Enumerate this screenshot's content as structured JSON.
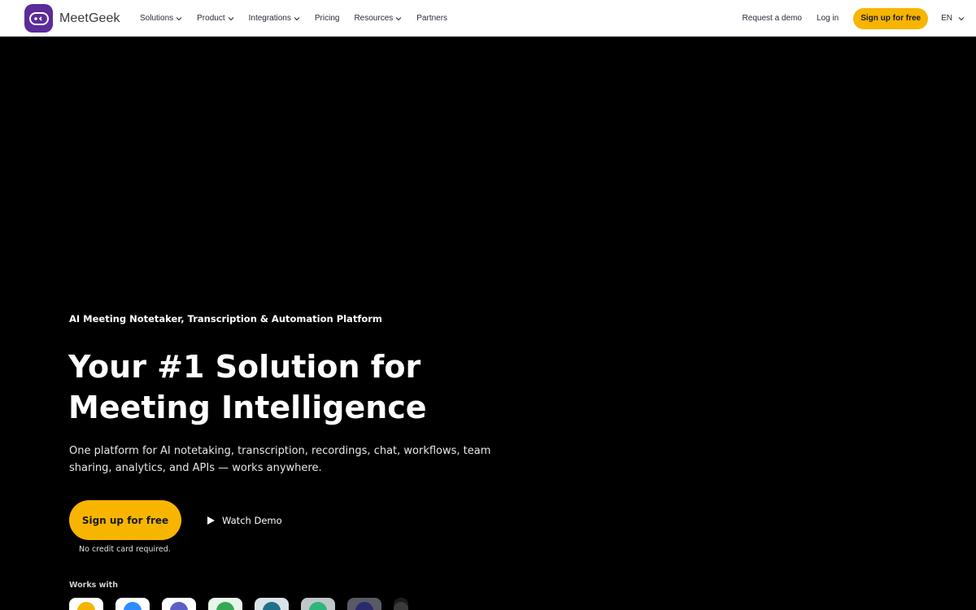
{
  "brand": {
    "name": "MeetGeek",
    "color": "#5b2c9a"
  },
  "nav": {
    "items": [
      {
        "label": "Solutions",
        "dropdown": true
      },
      {
        "label": "Product",
        "dropdown": true
      },
      {
        "label": "Integrations",
        "dropdown": true
      },
      {
        "label": "Pricing",
        "dropdown": false
      },
      {
        "label": "Resources",
        "dropdown": true
      },
      {
        "label": "Partners",
        "dropdown": false
      }
    ],
    "request_demo": "Request a demo",
    "login": "Log in",
    "signup": "Sign up for free",
    "language": "EN"
  },
  "hero": {
    "eyebrow": "AI Meeting Notetaker, Transcription & Automation Platform",
    "headline_line1": "Your #1 Solution for",
    "headline_line2": "Meeting Intelligence",
    "subtext": "One platform for AI notetaking, transcription, recordings, chat, workflows, team sharing, analytics, and APIs — works anywhere.",
    "cta_label": "Sign up for free",
    "watch_label": "Watch Demo",
    "no_cc": "No credit card required.",
    "works_with": "Works with"
  },
  "integrations": [
    {
      "icon": "google-meet-icon",
      "bg": "#ffffff",
      "color": "#f4b400"
    },
    {
      "icon": "zoom-icon",
      "bg": "#ffffff",
      "color": "#2d8cff"
    },
    {
      "icon": "microsoft-teams-icon",
      "bg": "#ffffff",
      "color": "#5b5fc7"
    },
    {
      "icon": "google-chat-icon",
      "bg": "#e8f5e9",
      "color": "#34a853"
    },
    {
      "icon": "webex-icon",
      "bg": "#d9e3e8",
      "color": "#1f6f8b"
    },
    {
      "icon": "slack-icon",
      "bg": "#bfc7c9",
      "color": "#2eb67d"
    },
    {
      "icon": "hubspot-icon",
      "bg": "#5a5a66",
      "color": "#2a2a6e"
    },
    {
      "icon": "more-icon",
      "bg": "#1c1c1c",
      "color": "#3a3a3a"
    }
  ],
  "colors": {
    "accent": "#f7b500",
    "background": "#000000"
  }
}
